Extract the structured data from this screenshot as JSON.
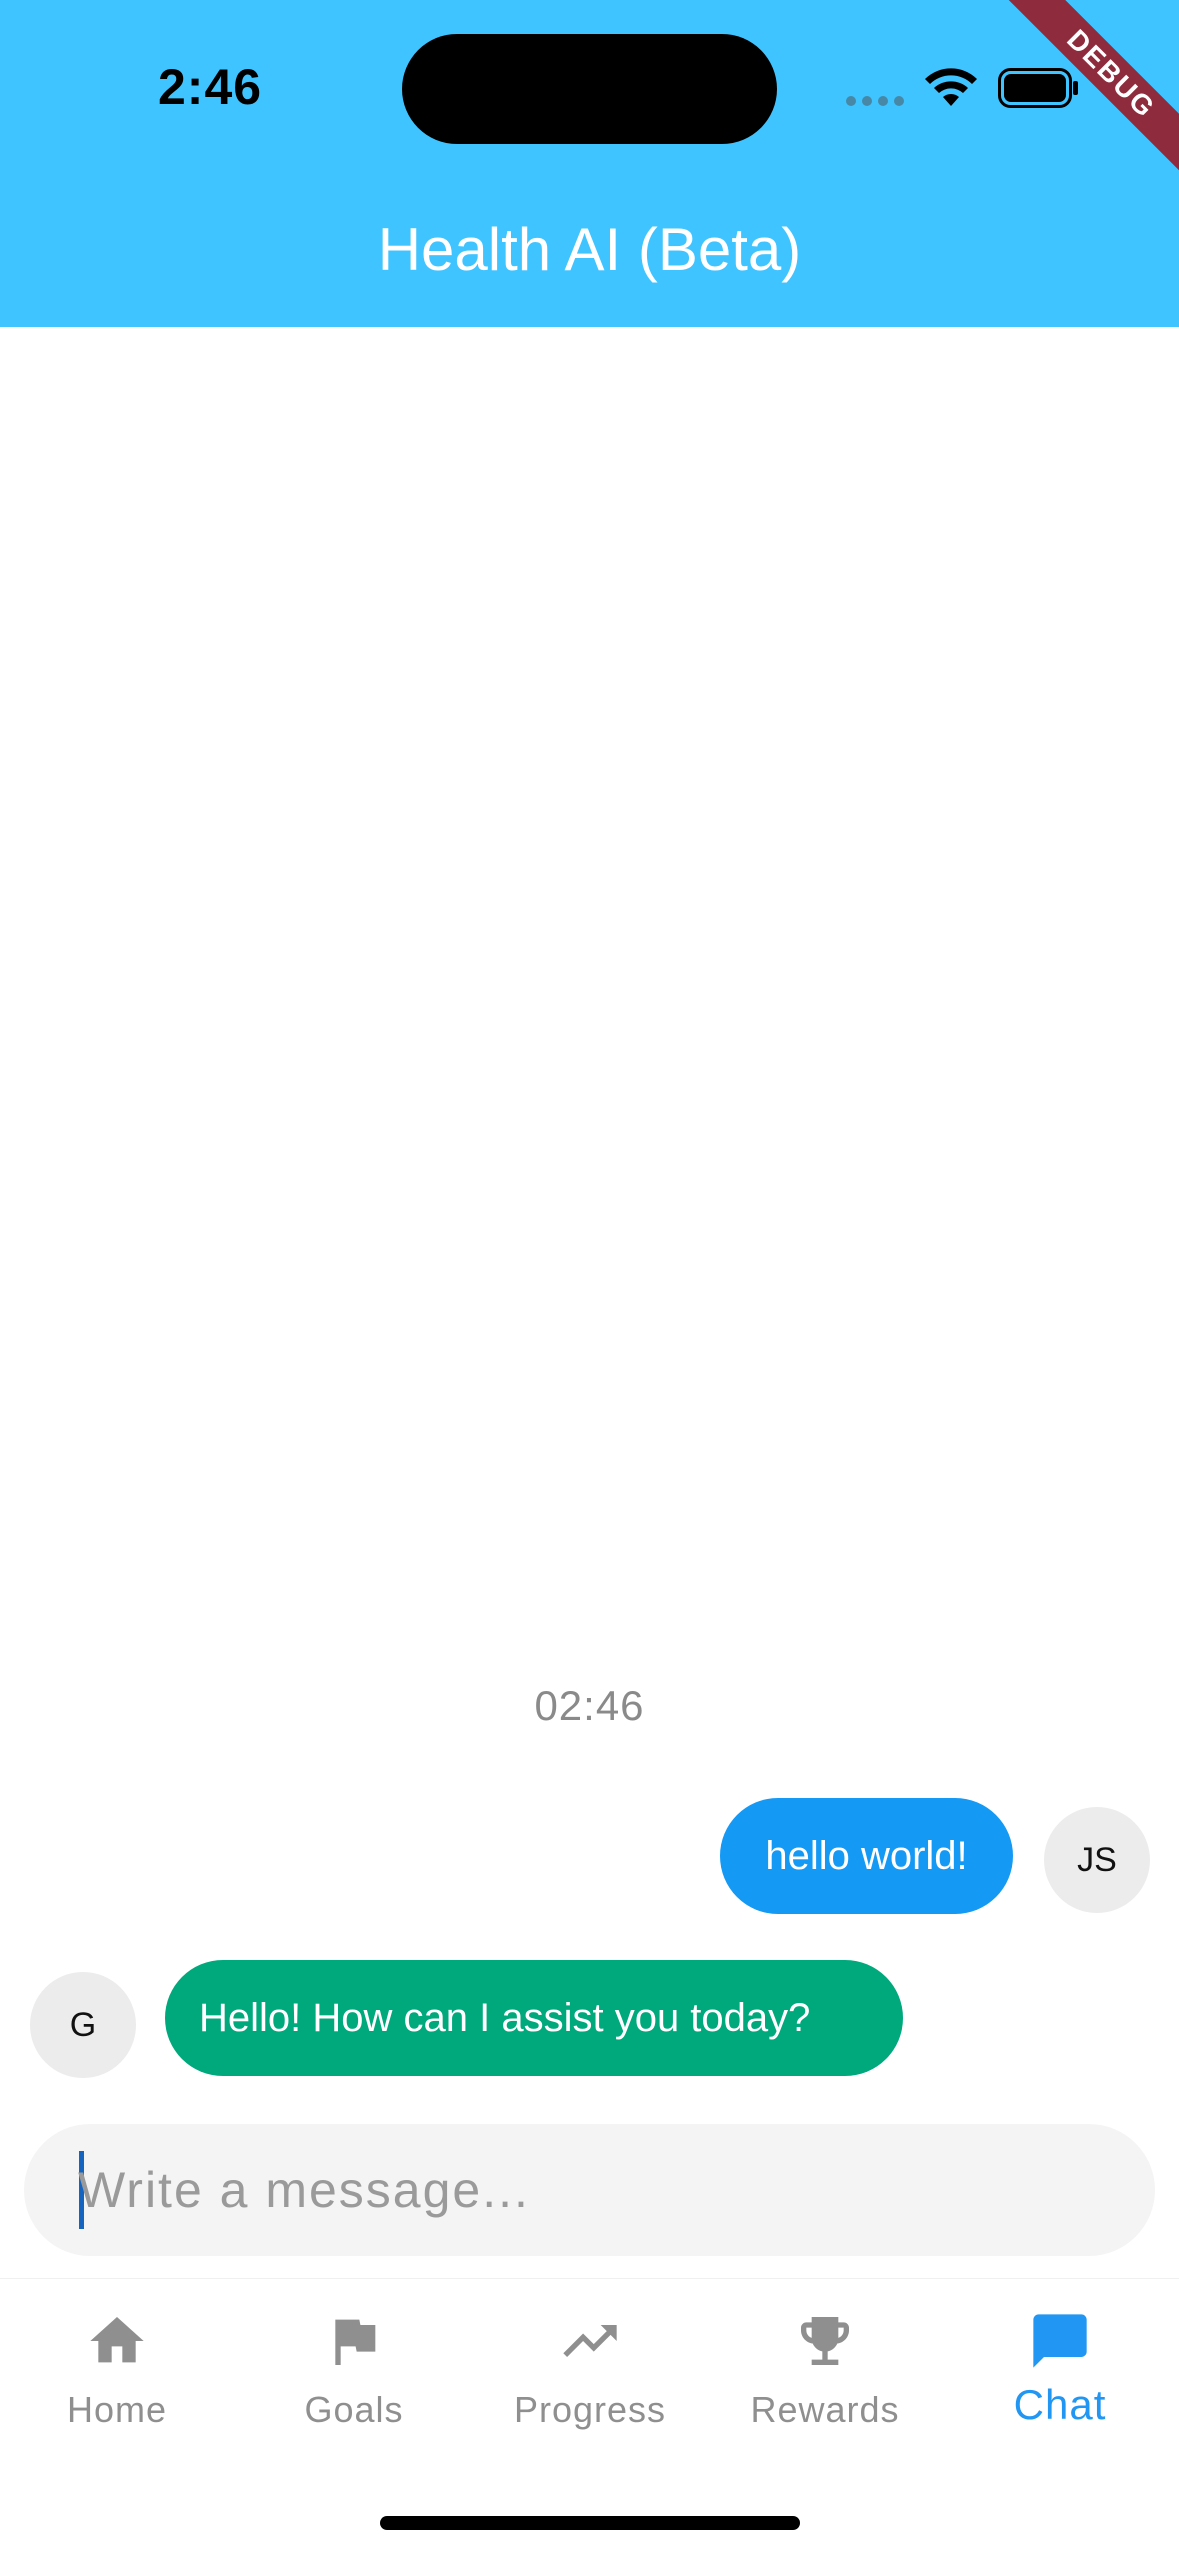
{
  "status_bar": {
    "time": "2:46",
    "icons": [
      "signal-dots-icon",
      "wifi-icon",
      "battery-icon"
    ]
  },
  "debug_banner": "DEBUG",
  "app_bar": {
    "title": "Health AI (Beta)",
    "background_color": "#40C4FF"
  },
  "chat": {
    "timestamp": "02:46",
    "messages": [
      {
        "author": "user",
        "avatar_initials": "JS",
        "text": "hello world!",
        "bubble_color": "#1499F5"
      },
      {
        "author": "bot",
        "avatar_initials": "G",
        "text": "Hello! How can I assist you today?",
        "bubble_color": "#00A97C"
      }
    ]
  },
  "composer": {
    "value": "",
    "placeholder": "Write a message..."
  },
  "bottom_nav": {
    "active": "Chat",
    "active_color": "#2196F3",
    "items": [
      {
        "label": "Home",
        "icon": "home-icon"
      },
      {
        "label": "Goals",
        "icon": "flag-icon"
      },
      {
        "label": "Progress",
        "icon": "trending-up-icon"
      },
      {
        "label": "Rewards",
        "icon": "trophy-icon"
      },
      {
        "label": "Chat",
        "icon": "chat-icon"
      }
    ]
  }
}
